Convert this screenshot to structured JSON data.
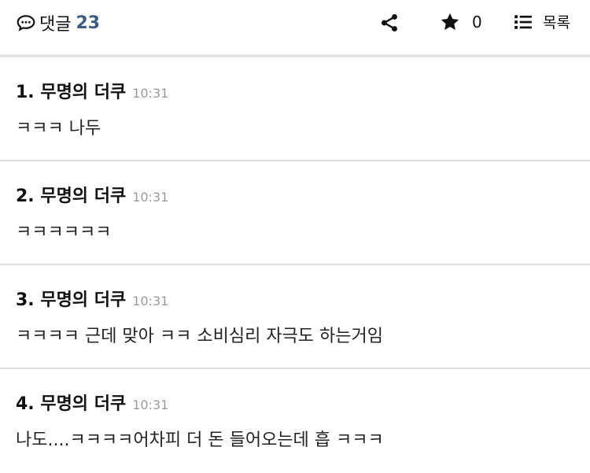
{
  "header": {
    "comment_label": "댓글",
    "comment_count": "23",
    "star_count": "0",
    "list_label": "목록",
    "icons": [
      "speech-bubble-icon",
      "share-icon",
      "star-icon",
      "list-icon"
    ]
  },
  "comments": [
    {
      "author": "1. 무명의 더쿠",
      "time": "10:31",
      "body": "ㅋㅋㅋ 나두"
    },
    {
      "author": "2. 무명의 더쿠",
      "time": "10:31",
      "body": "ㅋㅋㅋㅋㅋㅋ"
    },
    {
      "author": "3. 무명의 더쿠",
      "time": "10:31",
      "body": "ㅋㅋㅋㅋ 근데 맞아 ㅋㅋ 소비심리 자극도 하는거임"
    },
    {
      "author": "4. 무명의 더쿠",
      "time": "10:31",
      "body": "나도....ㅋㅋㅋㅋ어차피 더 돈 들어오는데 흡 ㅋㅋㅋ"
    }
  ]
}
